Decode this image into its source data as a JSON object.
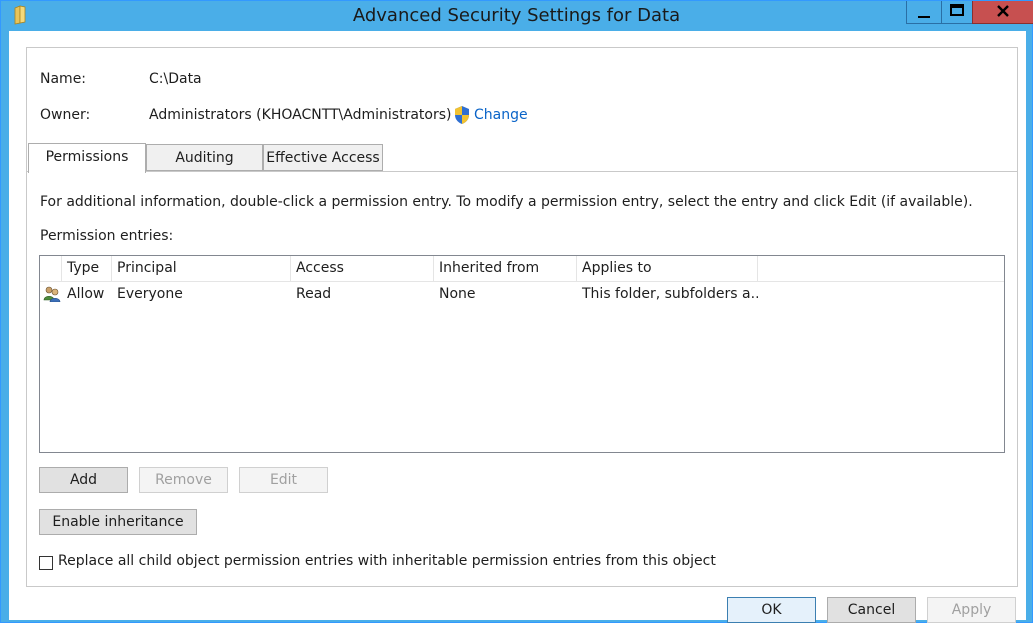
{
  "window": {
    "title": "Advanced Security Settings for Data",
    "app_icon": "folder-icon",
    "controls": {
      "minimize": "minimize-icon",
      "maximize": "maximize-icon",
      "close": "close-icon"
    }
  },
  "info": {
    "name_label": "Name:",
    "name_value": "C:\\Data",
    "owner_label": "Owner:",
    "owner_value": "Administrators (KHOACNTT\\Administrators)",
    "change_link": "Change",
    "change_icon": "uac-shield-icon"
  },
  "tabs": [
    {
      "label": "Permissions",
      "active": true
    },
    {
      "label": "Auditing",
      "active": false
    },
    {
      "label": "Effective Access",
      "active": false
    }
  ],
  "permissions": {
    "help_text": "For additional information, double-click a permission entry. To modify a permission entry, select the entry and click Edit (if available).",
    "entries_label": "Permission entries:",
    "columns": [
      "Type",
      "Principal",
      "Access",
      "Inherited from",
      "Applies to"
    ],
    "rows": [
      {
        "icon": "users-icon",
        "type": "Allow",
        "principal": "Everyone",
        "access": "Read",
        "inherited_from": "None",
        "applies_to": "This folder, subfolders a..."
      }
    ],
    "buttons": {
      "add": "Add",
      "remove": "Remove",
      "edit": "Edit"
    },
    "enable_inheritance": "Enable inheritance",
    "replace_checkbox_label": "Replace all child object permission entries with inheritable permission entries from this object",
    "replace_checked": false
  },
  "footer": {
    "ok": "OK",
    "cancel": "Cancel",
    "apply": "Apply"
  },
  "colors": {
    "titlebar": "#4aaee8",
    "close_button": "#c75050",
    "link": "#0a64c8"
  }
}
